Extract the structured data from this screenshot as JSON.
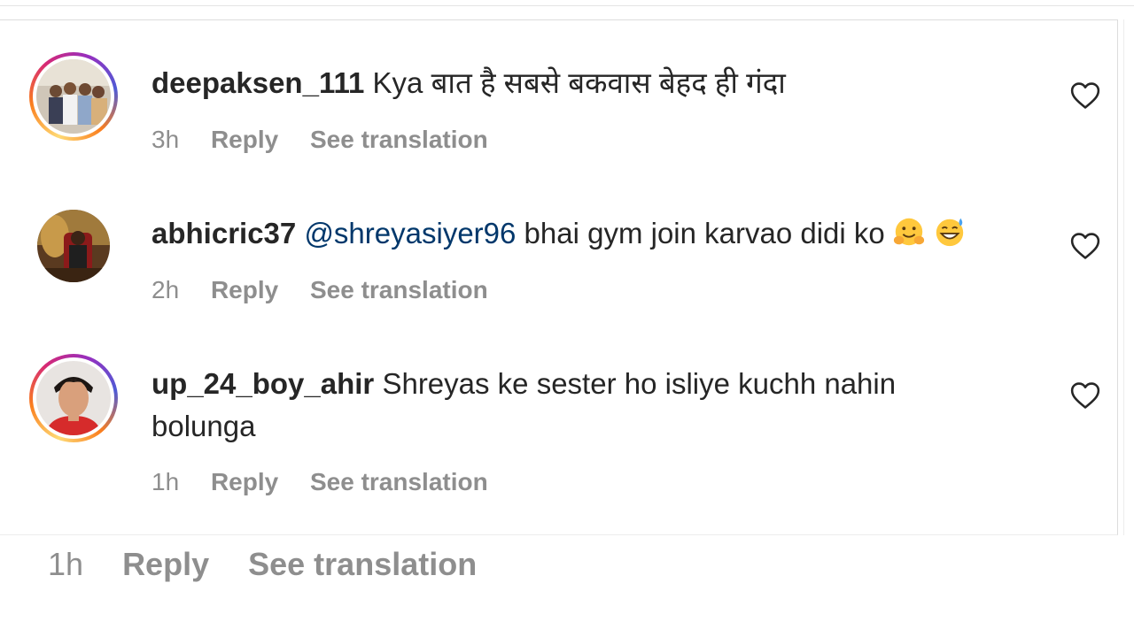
{
  "comments": [
    {
      "username": "deepaksen_111",
      "text": "Kya बात है सबसे बकवास बेहद ही गंदा",
      "mention": "",
      "time": "3h",
      "reply_label": "Reply",
      "translate_label": "See translation",
      "avatar": "group-photo-avatar",
      "has_story_ring": true
    },
    {
      "username": "abhicric37",
      "mention": "@shreyasiyer96",
      "text": "bhai gym join karvao didi ko",
      "emojis": [
        "hugging-face-emoji",
        "grinning-sweat-emoji"
      ],
      "time": "2h",
      "reply_label": "Reply",
      "translate_label": "See translation",
      "avatar": "person-on-chair-avatar",
      "has_story_ring": false
    },
    {
      "username": "up_24_boy_ahir",
      "text_line1": "Shreyas ke sester ho isliye kuchh nahin",
      "text_line2": "bolunga",
      "time": "1h",
      "reply_label": "Reply",
      "translate_label": "See translation",
      "avatar": "portrait-avatar",
      "has_story_ring": true
    }
  ],
  "footer": {
    "time": "1h",
    "reply_label": "Reply",
    "translate_label": "See translation"
  },
  "colors": {
    "text": "#262626",
    "meta": "#8e8e8e",
    "mention": "#00376b"
  }
}
